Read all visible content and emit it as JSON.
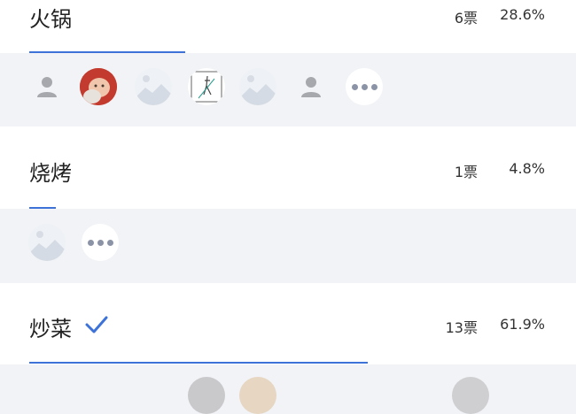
{
  "options": [
    {
      "label": "火锅",
      "votes": "6票",
      "percent": "28.6%",
      "fill": 0.286,
      "selected": false,
      "voters": [
        "default-avatar",
        "baby-photo-avatar",
        "mountain-placeholder-avatar",
        "sketch-avatar",
        "mountain-placeholder-avatar",
        "default-avatar",
        "more"
      ]
    },
    {
      "label": "烧烤",
      "votes": "1票",
      "percent": "4.8%",
      "fill": 0.048,
      "selected": false,
      "voters": [
        "mountain-placeholder-avatar",
        "more"
      ]
    },
    {
      "label": "炒菜",
      "votes": "13票",
      "percent": "61.9%",
      "fill": 0.619,
      "selected": true,
      "voters": []
    }
  ],
  "colors": {
    "accent": "#3d73d8",
    "background": "#f2f3f6",
    "more_dots": "#8b93a6"
  },
  "icons": {
    "selected": "checkmark-icon",
    "more": "more-dots-icon"
  }
}
